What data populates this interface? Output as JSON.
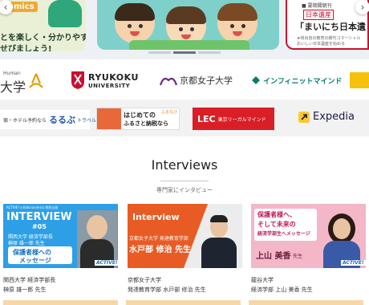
{
  "hero": {
    "left_tag": "omics",
    "left_line1": "とを楽しく・分かりやすく",
    "left_line2": "せびましょう!",
    "right_line1": "■ 要期聞朝刊",
    "right_line2": "日本遺産",
    "right_line3": "「まいにち日本遺",
    "right_line4": "★岐出自の教育の朝刊コマーシャル",
    "right_line5": "おいしい日本遺産を始める"
  },
  "logos_row1": {
    "logo1_small": "Human",
    "logo1_main": "大学",
    "logo2_line1": "RYUKOKU",
    "logo2_line2": "UNIVERSITY",
    "logo3": "京都女子大学",
    "logo4": "インフィニットマインド"
  },
  "logos_row2": {
    "logo1_prefix": "宿・ホテル予約なら",
    "logo1_main": "るるぶ",
    "logo1_sub": "トラベル",
    "logo2_line1": "はじめての",
    "logo2_line2": "ふるさと納税なら",
    "logo2_badge": "ふるなび",
    "logo3_main": "LEC",
    "logo3_sub": "東京リーガルマインド",
    "logo4": "Expedia"
  },
  "interviews": {
    "title": "Interviews",
    "subtitle": "専門家にインタビュー",
    "cards": [
      {
        "thumb_header": "ACTIVE! x Kidsnavimics 特別企画",
        "thumb_title": "INTERVIEW",
        "thumb_num": "#05",
        "thumb_line1": "関西大学 経済学部長",
        "thumb_line2": "榊原 雄一郎 先生",
        "thumb_line3": "保護者様への",
        "thumb_line4": "メッセージ",
        "caption1": "関西大学 経済学部長",
        "caption2": "榊原 雄一郎 先生"
      },
      {
        "thumb_title": "Interview",
        "thumb_line1": "京都女子大学 発達教育学部",
        "thumb_line2": "水戸部 修治 先生",
        "caption1": "京都女子大学",
        "caption2": "発達教育学部 水戸部 修治 先生"
      },
      {
        "thumb_line1": "保護者様へ、",
        "thumb_line2": "そして未来の",
        "thumb_line3": "経済学部生へメッセージ",
        "thumb_line4": "上山 美香",
        "thumb_line4b": "先生",
        "caption1": "龍谷大学",
        "caption2": "経済学部 上山 美香 先生"
      }
    ],
    "badge": "ACTIVE!"
  },
  "colors": {
    "brand_red": "#c8102e",
    "ryukoku_red": "#c8102e",
    "kyoto_purple": "#6b2c82",
    "lec_red": "#d91e26",
    "rurubu_blue": "#1f56a8",
    "expedia_yellow": "#ffc72c"
  },
  "icons": [
    "chevron-left-icon",
    "chevron-right-icon"
  ]
}
